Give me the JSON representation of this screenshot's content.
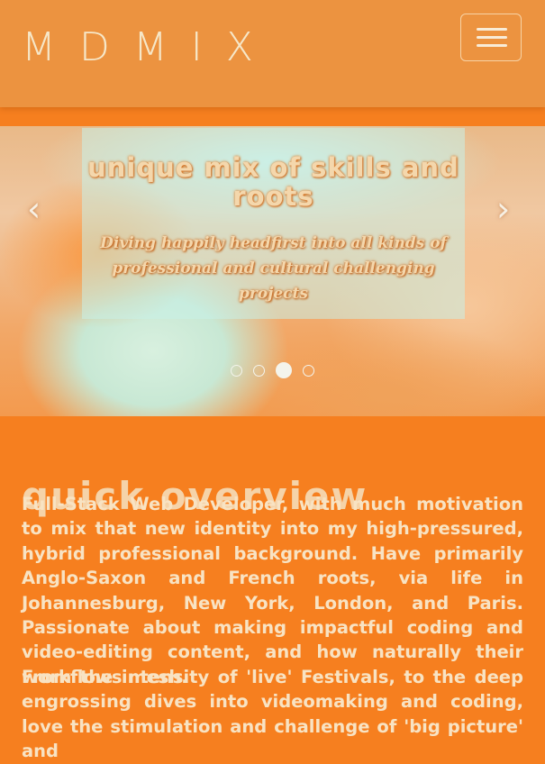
{
  "navbar": {
    "brand": "MDMIX",
    "toggle_icon": "hamburger-menu-icon"
  },
  "carousel": {
    "slide": {
      "title": "Unique mix of skills and roots",
      "text": "Diving happily headfirst into all kinds of professional and cultural challenging projects"
    },
    "prev_icon": "chevron-left-icon",
    "next_icon": "chevron-right-icon",
    "indicator_count": 4,
    "active_index": 2
  },
  "overview": {
    "title": "Quick overview",
    "paragraphs": [
      "Full-Stack Web Developer, with much motivation to mix that new identity into my high-pressured, hybrid professional background. Have primarily Anglo-Saxon and French roots, via life in Johannesburg, New York, London, and Paris. Passionate about making impactful coding and video-editing content, and how naturally their workflows mesh.",
      "From the intensity of 'live' Festivals, to the deep engrossing dives into videomaking and coding, love the stimulation and challenge of 'big picture' and"
    ]
  },
  "colors": {
    "background": "#f67f1f",
    "navbar": "#ec9340",
    "text_light": "#f8e3c3"
  }
}
